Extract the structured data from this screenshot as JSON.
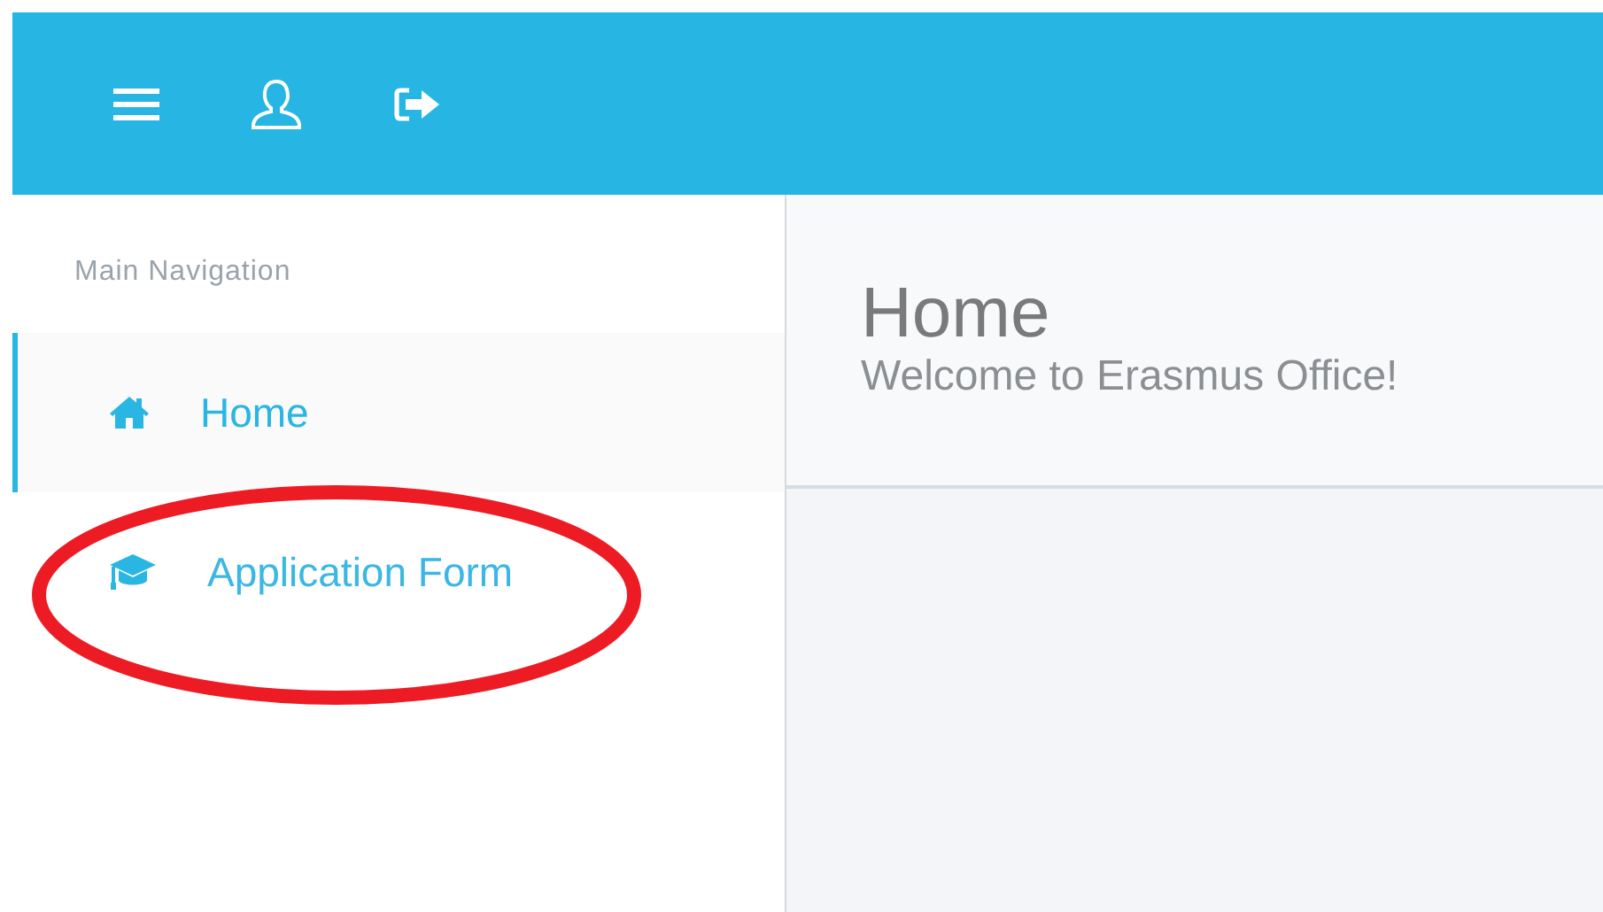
{
  "top_bar": {
    "icons": [
      {
        "kind": "menu"
      },
      {
        "kind": "user"
      },
      {
        "kind": "logout"
      }
    ]
  },
  "sidebar": {
    "heading": "Main Navigation",
    "items": [
      {
        "label": "Home",
        "kind": "home",
        "selected": true
      },
      {
        "label": "Application Form",
        "kind": "graduation-cap",
        "selected": false
      }
    ]
  },
  "content": {
    "title": "Home",
    "subtitle": "Welcome to Erasmus Office!"
  },
  "annotation": {
    "kind": "ellipse"
  }
}
